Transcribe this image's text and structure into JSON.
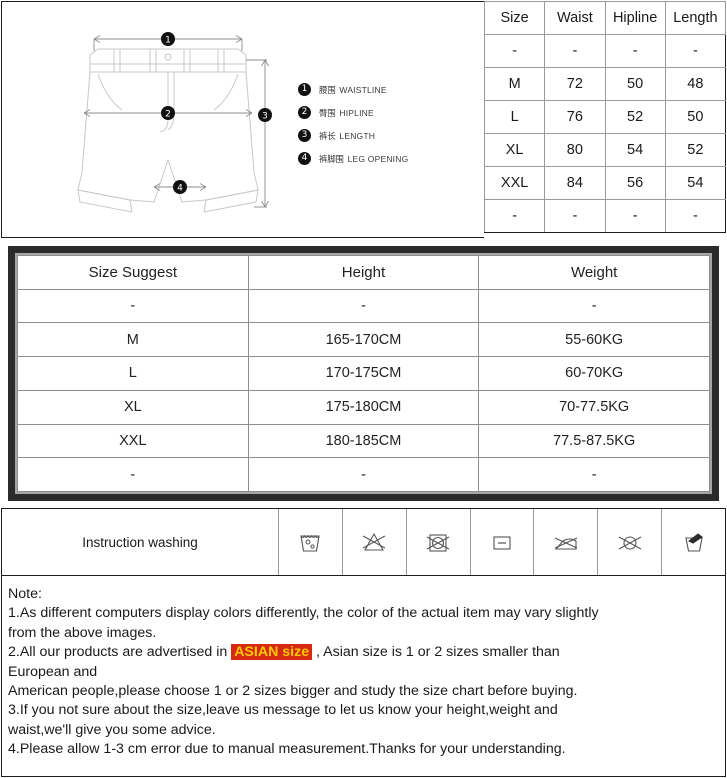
{
  "diagram": {
    "alt": "technical line drawing of shorts with measurement arrows",
    "legend": [
      {
        "num": "1",
        "cn": "腰围",
        "en": "WAISTLINE"
      },
      {
        "num": "2",
        "cn": "臀围",
        "en": "HIPLINE"
      },
      {
        "num": "3",
        "cn": "裤长",
        "en": "LENGTH"
      },
      {
        "num": "4",
        "cn": "裤脚围",
        "en": "LEG OPENING"
      }
    ],
    "markers": [
      "1",
      "2",
      "3",
      "4"
    ]
  },
  "measurement_table": {
    "headers": [
      "Size",
      "Waist",
      "Hipline",
      "Length"
    ],
    "rows": [
      [
        "-",
        "-",
        "-",
        "-"
      ],
      [
        "M",
        "72",
        "50",
        "48"
      ],
      [
        "L",
        "76",
        "52",
        "50"
      ],
      [
        "XL",
        "80",
        "54",
        "52"
      ],
      [
        "XXL",
        "84",
        "56",
        "54"
      ],
      [
        "-",
        "-",
        "-",
        "-"
      ]
    ]
  },
  "suggest_table": {
    "headers": [
      "Size Suggest",
      "Height",
      "Weight"
    ],
    "rows": [
      [
        "-",
        "-",
        "-"
      ],
      [
        "M",
        "165-170CM",
        "55-60KG"
      ],
      [
        "L",
        "170-175CM",
        "60-70KG"
      ],
      [
        "XL",
        "175-180CM",
        "70-77.5KG"
      ],
      [
        "XXL",
        "180-185CM",
        "77.5-87.5KG"
      ],
      [
        "-",
        "-",
        "-"
      ]
    ]
  },
  "washing": {
    "label": "Instruction washing",
    "icons": [
      "machine-wash-icon",
      "do-not-bleach-icon",
      "do-not-tumble-dry-icon",
      "flat-dry-icon",
      "do-not-iron-icon",
      "do-not-dry-clean-icon",
      "hand-wash-icon"
    ]
  },
  "note": {
    "title": "Note:",
    "line1a": "1.As different computers display colors differently, the color of the actual item may vary slightly",
    "line1b": "from the above images.",
    "line2a": "2.All our products are advertised in ",
    "highlight": "ASIAN size",
    "line2b": " , Asian size is 1 or 2 sizes smaller than",
    "line2c": "European and",
    "line2d": "American people,please choose 1 or 2 sizes bigger and study the size chart before buying.",
    "line3a": "3.If you not sure about the size,leave us message to let us know your height,weight and",
    "line3b": "waist,we'll give you some advice.",
    "line4": "4.Please allow 1-3 cm error due to manual measurement.Thanks for your understanding."
  },
  "colors": {
    "highlight_bg": "#d42a12",
    "highlight_text": "#ffc800",
    "table_border": "#2b2b2b"
  }
}
